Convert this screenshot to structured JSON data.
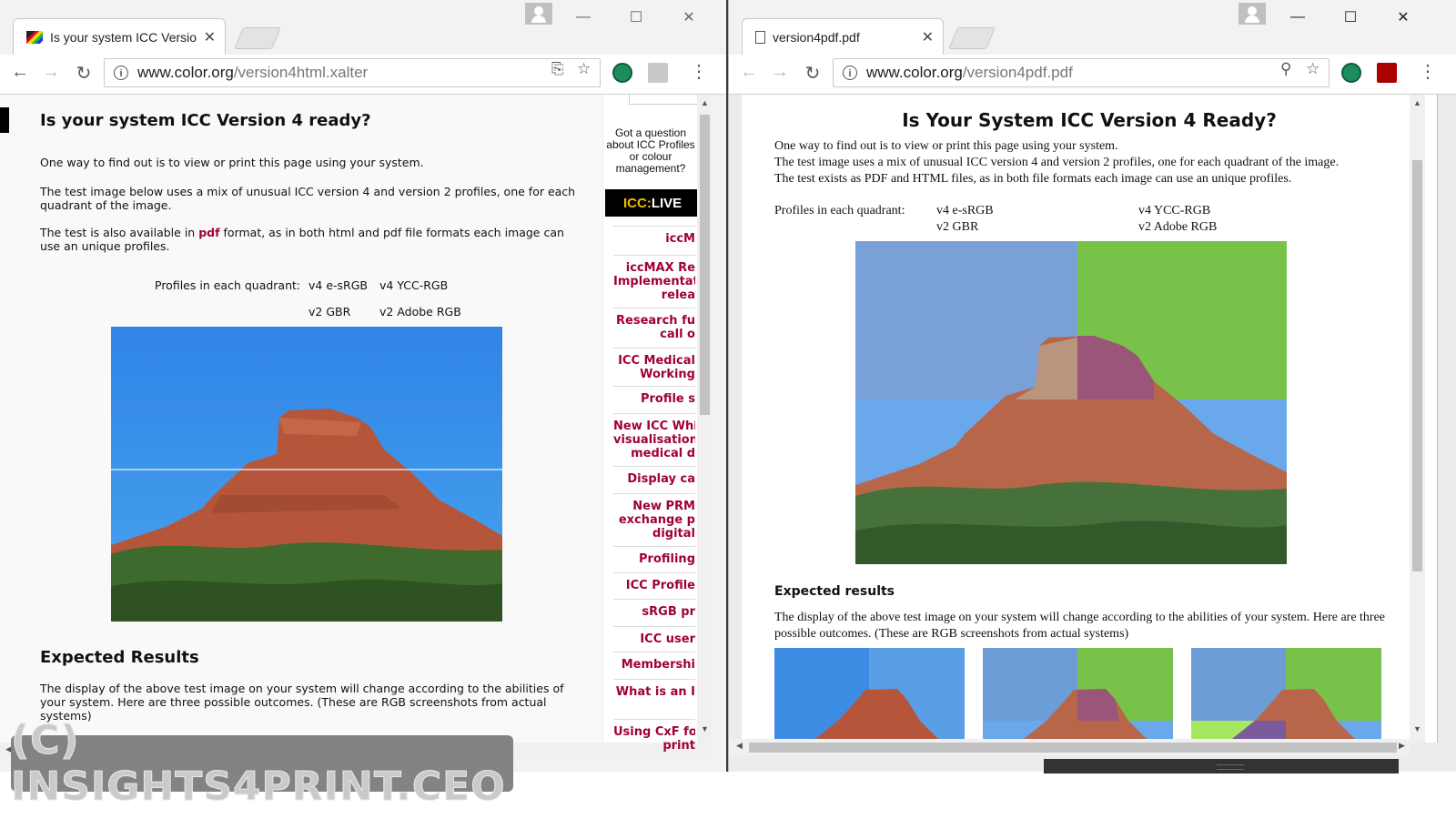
{
  "left_window": {
    "tab_title": "Is your system ICC Versio",
    "url_host": "www.color.org",
    "url_path": "/version4html.xalter",
    "page": {
      "heading": "Is your system ICC Version 4 ready?",
      "para1": "One way to find out is to view or print this page using your system.",
      "para2": "The test image below uses a mix of unusual ICC version 4 and version 2 profiles, one for each quadrant of the image.",
      "para3_pre": "The test is also available in ",
      "para3_link": "pdf",
      "para3_post": " format, as in both html and pdf file formats each image can use an unique profiles.",
      "quadrant_label": "Profiles in each quadrant:",
      "q_tl": "v4 e-sRGB",
      "q_tr": "v4 YCC-RGB",
      "q_bl": "v2 GBR",
      "q_br": "v2 Adobe RGB",
      "expected_heading": "Expected Results",
      "expected_text": "The display of the above test image on your system will change according to the abilities of your system. Here are three possible outcomes. (These are RGB screenshots from actual systems)"
    },
    "sidebar": {
      "question": "Got a question about ICC Profiles or colour management?",
      "banner_accent": "ICC:",
      "banner_text": " LIVE",
      "items": [
        "iccM",
        "iccMAX Re\nImplementat\nrelea",
        "Research fu\ncall o",
        "ICC Medical\nWorking",
        "Profile s",
        "New ICC Whi\nvisualisation \nmedical d",
        "Display ca",
        "New PRM\nexchange p\ndigital",
        "Profiling",
        "ICC Profile",
        "sRGB pr",
        "ICC user",
        "Membershi",
        "What is an I",
        "Using CxF fo\nprint"
      ]
    }
  },
  "right_window": {
    "tab_title": "version4pdf.pdf",
    "url_host": "www.color.org",
    "url_path": "/version4pdf.pdf",
    "page": {
      "heading": "Is Your System ICC Version 4 Ready?",
      "line1": "One way to find out is to view or print this page using your system.",
      "line2": "The test image uses a mix of unusual ICC version 4 and version 2 profiles, one for each quadrant of the image.",
      "line3": "The test exists as PDF and HTML files, as in both file formats each image can use an unique profiles.",
      "quadrant_label": "Profiles in each quadrant:",
      "q_tl": "v4 e-sRGB",
      "q_tr": "v4 YCC-RGB",
      "q_bl": "v2 GBR",
      "q_br": "v2 Adobe RGB",
      "expected_heading": "Expected results",
      "expected_text": "The display of the above test image on your system will change according to the abilities of your system. Here are three possible outcomes. (These are RGB screenshots from actual systems)"
    }
  },
  "window_controls": {
    "minimize": "—",
    "maximize": "☐",
    "close": "✕"
  },
  "watermark": "(C) INSIGHTS4PRINT.CEO",
  "colors": {
    "link": "#a0003a",
    "sky": "#3d8fe0",
    "rock": "#b5563a",
    "green_tint": "#6fbe3c"
  }
}
